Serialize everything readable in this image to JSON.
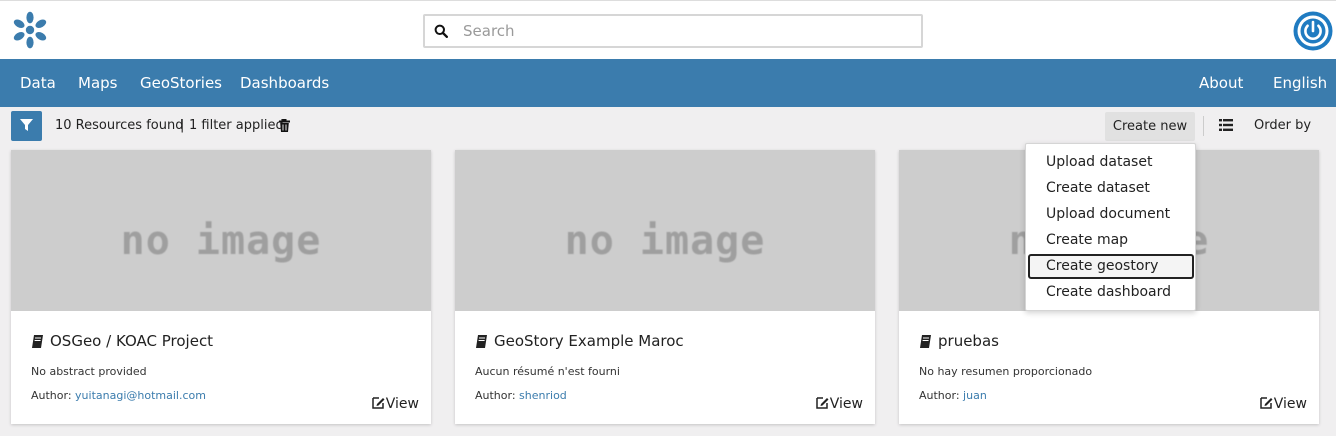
{
  "header": {
    "logo_icon": "geonode-logo-icon",
    "search_placeholder": "Search",
    "power_icon": "power-icon",
    "brand_color": "#3b7cad"
  },
  "nav": {
    "left": [
      "Data",
      "Maps",
      "GeoStories",
      "Dashboards"
    ],
    "right": [
      "About",
      "English"
    ]
  },
  "toolbar": {
    "resources_found": "10 Resources found",
    "separator": "|",
    "filters_applied": "1 filter applied",
    "create_new": "Create new",
    "order_by": "Order by"
  },
  "create_menu": {
    "items": [
      "Upload dataset",
      "Create dataset",
      "Upload document",
      "Create map",
      "Create geostory",
      "Create dashboard"
    ],
    "highlighted": "Create geostory"
  },
  "cards": [
    {
      "thumbnail_text": "no image",
      "title": "OSGeo / KOAC Project",
      "abstract": "No abstract provided",
      "author_label": "Author:",
      "author": "yuitanagi@hotmail.com",
      "view": "View"
    },
    {
      "thumbnail_text": "no image",
      "title": "GeoStory Example Maroc",
      "abstract": "Aucun résumé n'est fourni",
      "author_label": "Author:",
      "author": "shenriod",
      "view": "View"
    },
    {
      "thumbnail_text": "no image",
      "title": "pruebas",
      "abstract": "No hay resumen proporcionado",
      "author_label": "Author:",
      "author": "juan",
      "view": "View"
    }
  ]
}
